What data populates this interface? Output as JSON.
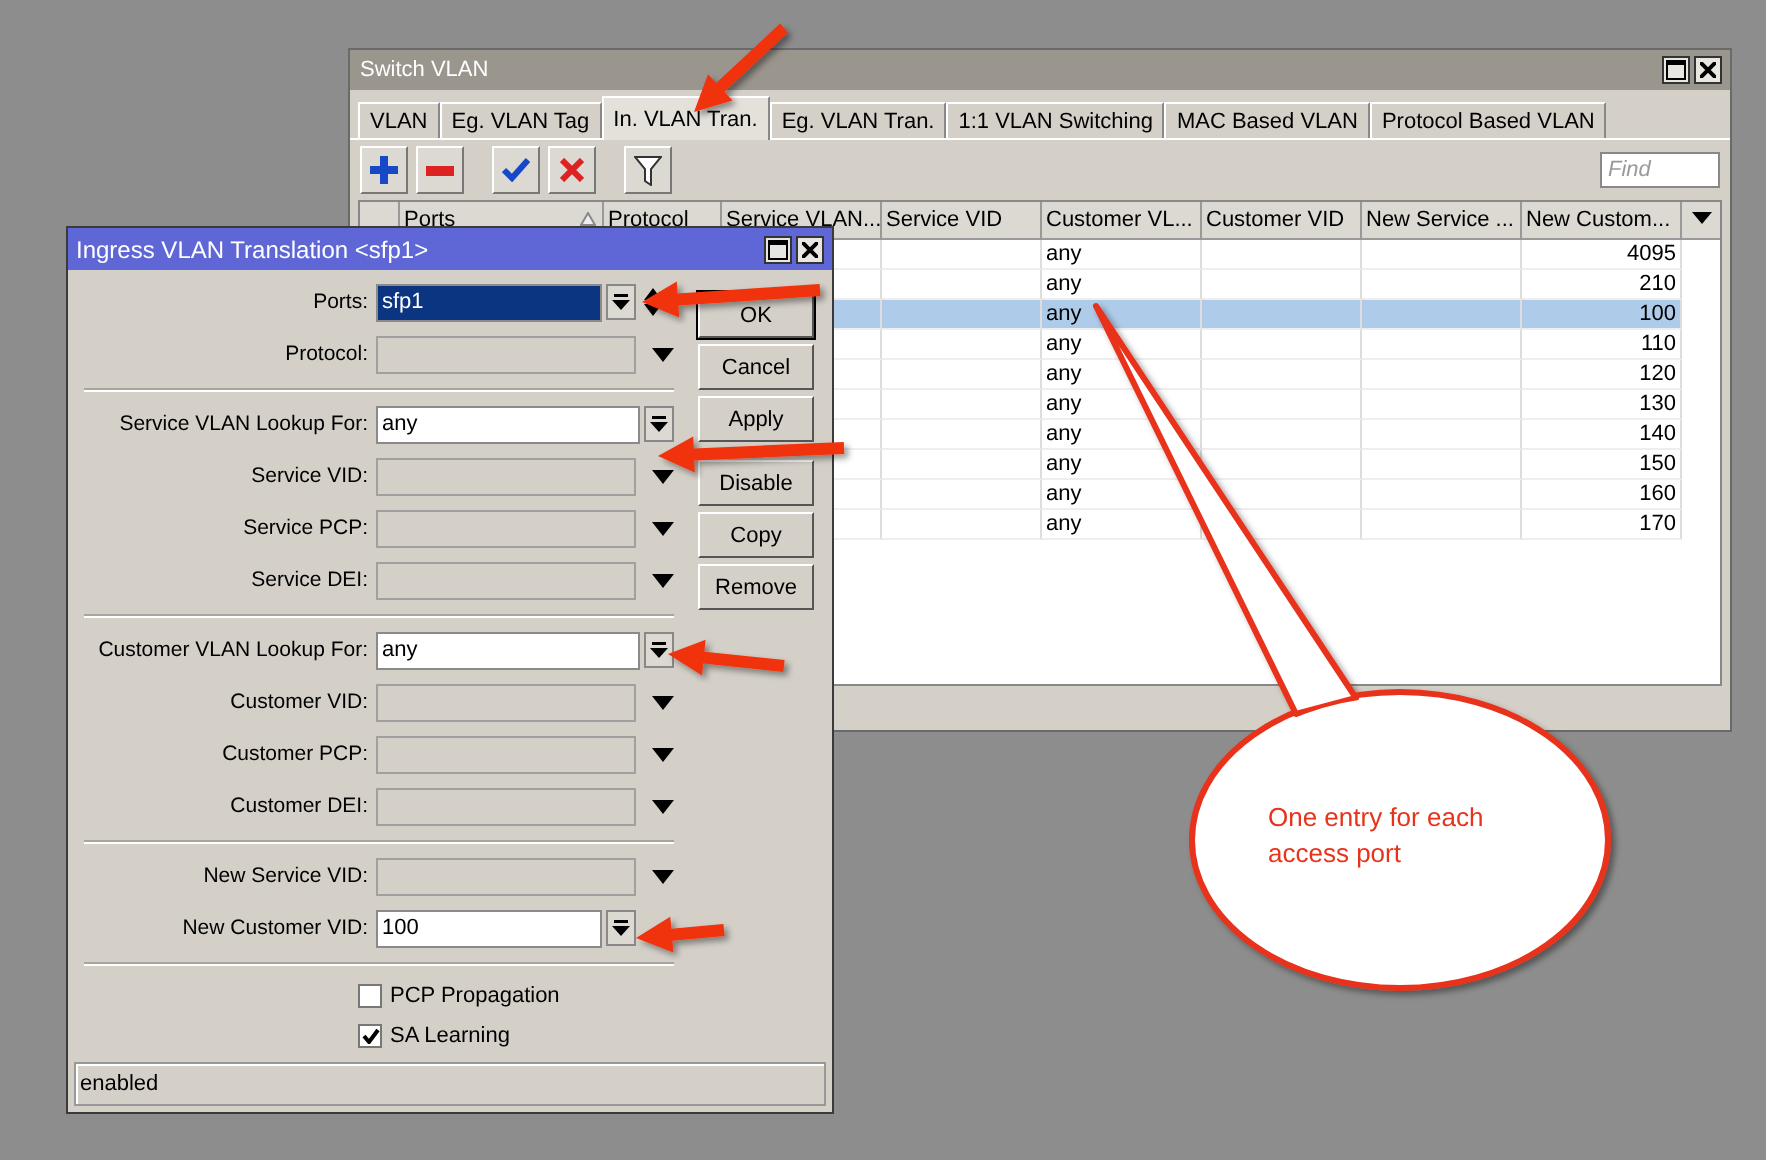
{
  "switch_window": {
    "title": "Switch VLAN",
    "tabs": [
      {
        "label": "VLAN",
        "selected": false
      },
      {
        "label": "Eg. VLAN Tag",
        "selected": false
      },
      {
        "label": "In. VLAN Tran.",
        "selected": true
      },
      {
        "label": "Eg. VLAN Tran.",
        "selected": false
      },
      {
        "label": "1:1 VLAN Switching",
        "selected": false
      },
      {
        "label": "MAC Based VLAN",
        "selected": false
      },
      {
        "label": "Protocol Based VLAN",
        "selected": false
      }
    ],
    "toolbar": [
      {
        "kind": "add"
      },
      {
        "kind": "remove"
      },
      {
        "kind": "enable"
      },
      {
        "kind": "disable"
      },
      {
        "kind": "filter"
      }
    ],
    "search": {
      "placeholder": "Find"
    },
    "table": {
      "columns": [
        {
          "label": "Ports",
          "sorted": true
        },
        {
          "label": "Protocol",
          "sorted": false
        },
        {
          "label": "Service VLAN...",
          "sorted": false
        },
        {
          "label": "Service VID",
          "sorted": false
        },
        {
          "label": "Customer VL...",
          "sorted": false
        },
        {
          "label": "Customer VID",
          "sorted": false
        },
        {
          "label": "New Service ...",
          "sorted": false
        },
        {
          "label": "New Custom...",
          "sorted": false
        }
      ],
      "rows": [
        {
          "customer_vlan_lookup": "any",
          "new_customer_vid": "4095",
          "selected": false
        },
        {
          "customer_vlan_lookup": "any",
          "new_customer_vid": "210",
          "selected": false
        },
        {
          "customer_vlan_lookup": "any",
          "new_customer_vid": "100",
          "selected": true
        },
        {
          "customer_vlan_lookup": "any",
          "new_customer_vid": "110",
          "selected": false
        },
        {
          "customer_vlan_lookup": "any",
          "new_customer_vid": "120",
          "selected": false
        },
        {
          "customer_vlan_lookup": "any",
          "new_customer_vid": "130",
          "selected": false
        },
        {
          "customer_vlan_lookup": "any",
          "new_customer_vid": "140",
          "selected": false
        },
        {
          "customer_vlan_lookup": "any",
          "new_customer_vid": "150",
          "selected": false
        },
        {
          "customer_vlan_lookup": "any",
          "new_customer_vid": "160",
          "selected": false
        },
        {
          "customer_vlan_lookup": "any",
          "new_customer_vid": "170",
          "selected": false
        }
      ]
    }
  },
  "dialog": {
    "title": "Ingress VLAN Translation <sfp1>",
    "sections": [
      {
        "fields": [
          {
            "label": "Ports:",
            "kind": "numeric",
            "value": "sfp1",
            "focused": true,
            "spinner": true
          },
          {
            "label": "Protocol:",
            "kind": "empty"
          }
        ]
      },
      {
        "fields": [
          {
            "label": "Service VLAN Lookup For:",
            "kind": "combo",
            "value": "any",
            "focused": false
          },
          {
            "label": "Service VID:",
            "kind": "empty"
          },
          {
            "label": "Service PCP:",
            "kind": "empty"
          },
          {
            "label": "Service DEI:",
            "kind": "empty"
          }
        ]
      },
      {
        "fields": [
          {
            "label": "Customer VLAN Lookup For:",
            "kind": "combo",
            "value": "any",
            "focused": false
          },
          {
            "label": "Customer VID:",
            "kind": "empty"
          },
          {
            "label": "Customer PCP:",
            "kind": "empty"
          },
          {
            "label": "Customer DEI:",
            "kind": "empty"
          }
        ]
      },
      {
        "fields": [
          {
            "label": "New Service VID:",
            "kind": "empty"
          },
          {
            "label": "New Customer VID:",
            "kind": "numeric",
            "value": "100",
            "focused": false,
            "spinner": false
          }
        ]
      }
    ],
    "options": [
      {
        "label": "PCP Propagation",
        "checked": false
      },
      {
        "label": "SA Learning",
        "checked": true
      }
    ],
    "buttons": [
      "OK",
      "Cancel",
      "Apply",
      "Disable",
      "Copy",
      "Remove"
    ],
    "status": "enabled"
  },
  "callout": {
    "text": "One entry for each access port"
  }
}
